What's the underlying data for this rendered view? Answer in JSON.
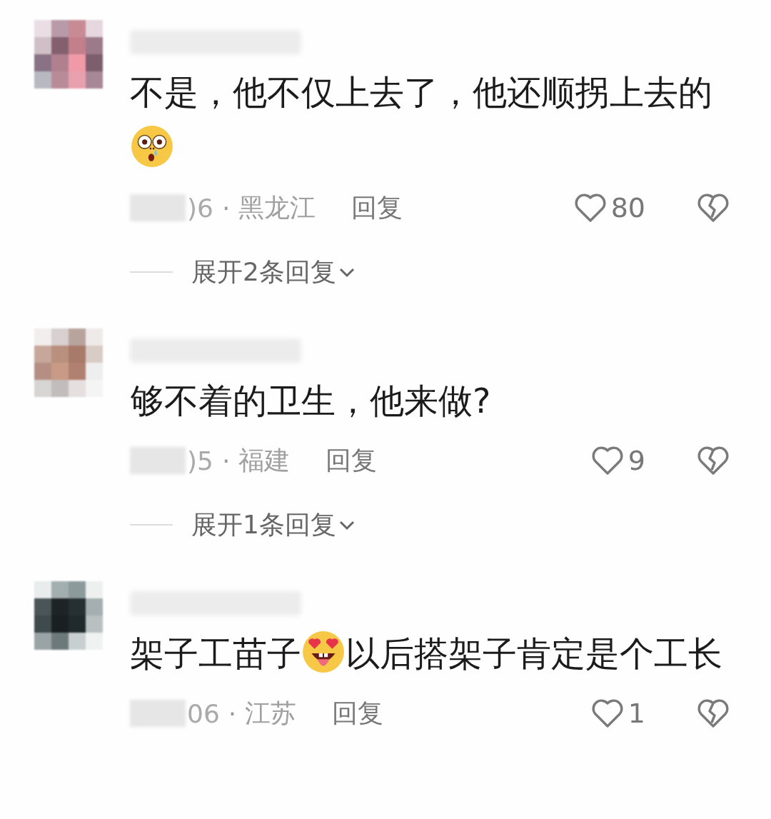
{
  "comments": [
    {
      "body": [
        {
          "kind": "text",
          "text": "不是，他不仅上去了，他还顺拐上去的"
        },
        {
          "kind": "shocked"
        }
      ],
      "date": ")6",
      "separator": "·",
      "region": "黑龙江",
      "reply": "回复",
      "likes": "80",
      "expand": "展开2条回复"
    },
    {
      "body": [
        {
          "kind": "text",
          "text": "够不着的卫生，他来做?"
        }
      ],
      "date": ")5",
      "separator": "·",
      "region": "福建",
      "reply": "回复",
      "likes": "9",
      "expand": "展开1条回复"
    },
    {
      "body": [
        {
          "kind": "text",
          "text": "架子工苗子"
        },
        {
          "kind": "adoring"
        },
        {
          "kind": "text",
          "text": "以后搭架子肯定是个工长"
        }
      ],
      "date": "06",
      "separator": "·",
      "region": "江苏",
      "reply": "回复",
      "likes": "1"
    }
  ]
}
